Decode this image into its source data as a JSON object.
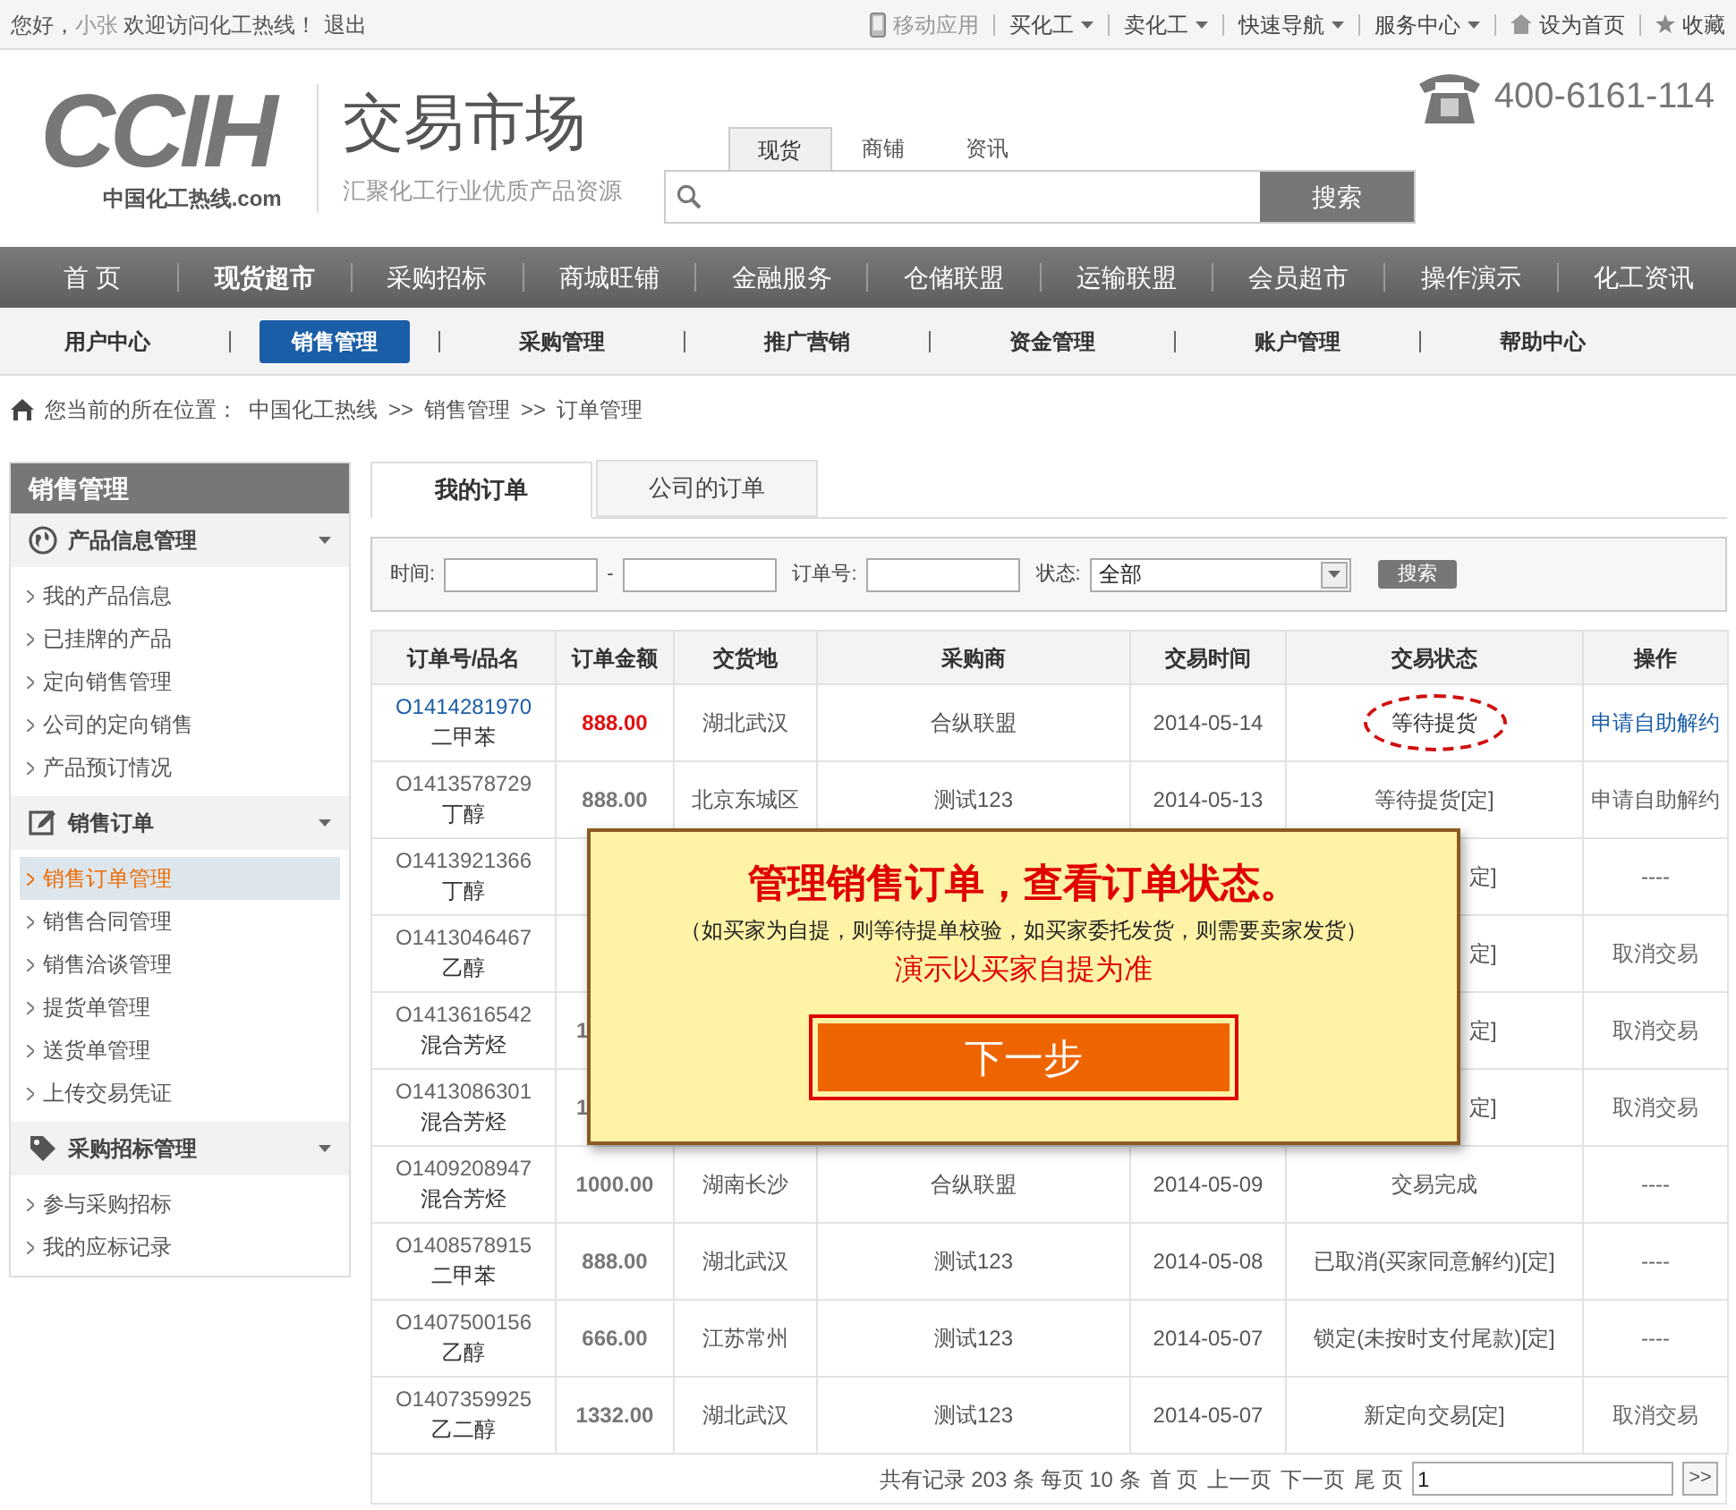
{
  "top_bar": {
    "greeting": "您好，",
    "user": "小张",
    "welcome": "欢迎访问化工热线！",
    "logout": "退出",
    "links": [
      {
        "label": "移动应用",
        "kind": "phone",
        "dropdown": false
      },
      {
        "label": "买化工",
        "kind": "text",
        "dropdown": true
      },
      {
        "label": "卖化工",
        "kind": "text",
        "dropdown": true
      },
      {
        "label": "快速导航",
        "kind": "text",
        "dropdown": true
      },
      {
        "label": "服务中心",
        "kind": "text",
        "dropdown": true
      },
      {
        "label": "设为首页",
        "kind": "home",
        "dropdown": false
      },
      {
        "label": "收藏",
        "kind": "star",
        "dropdown": false
      }
    ]
  },
  "header": {
    "logo_text": "CCIH",
    "logo_sub": "中国化工热线.com",
    "site_title": "交易市场",
    "slogan": "汇聚化工行业优质产品资源",
    "search_tabs": [
      {
        "label": "现货",
        "selected": true
      },
      {
        "label": "商铺",
        "selected": false
      },
      {
        "label": "资讯",
        "selected": false
      }
    ],
    "search_button": "搜索",
    "phone": "400-6161-114"
  },
  "main_nav": [
    {
      "label": "首 页",
      "selected": false
    },
    {
      "label": "现货超市",
      "selected": true
    },
    {
      "label": "采购招标",
      "selected": false
    },
    {
      "label": "商城旺铺",
      "selected": false
    },
    {
      "label": "金融服务",
      "selected": false
    },
    {
      "label": "仓储联盟",
      "selected": false
    },
    {
      "label": "运输联盟",
      "selected": false
    },
    {
      "label": "会员超市",
      "selected": false
    },
    {
      "label": "操作演示",
      "selected": false
    },
    {
      "label": "化工资讯",
      "selected": false
    }
  ],
  "sub_nav": [
    {
      "label": "用户中心",
      "selected": false
    },
    {
      "label": "销售管理",
      "selected": true
    },
    {
      "label": "采购管理",
      "selected": false
    },
    {
      "label": "推广营销",
      "selected": false
    },
    {
      "label": "资金管理",
      "selected": false
    },
    {
      "label": "账户管理",
      "selected": false
    },
    {
      "label": "帮助中心",
      "selected": false
    }
  ],
  "breadcrumb": {
    "prefix": "您当前的所在位置：",
    "items": [
      "中国化工热线",
      "销售管理",
      "订单管理"
    ],
    "separator": ">>"
  },
  "sidebar": {
    "title": "销售管理",
    "groups": [
      {
        "label": "产品信息管理",
        "kind": "globe",
        "expanded": true,
        "items": [
          {
            "label": "我的产品信息",
            "selected": false
          },
          {
            "label": "已挂牌的产品",
            "selected": false
          },
          {
            "label": "定向销售管理",
            "selected": false
          },
          {
            "label": "公司的定向销售",
            "selected": false
          },
          {
            "label": "产品预订情况",
            "selected": false
          }
        ]
      },
      {
        "label": "销售订单",
        "kind": "edit",
        "expanded": true,
        "items": [
          {
            "label": "销售订单管理",
            "selected": true
          },
          {
            "label": "销售合同管理",
            "selected": false
          },
          {
            "label": "销售洽谈管理",
            "selected": false
          },
          {
            "label": "提货单管理",
            "selected": false
          },
          {
            "label": "送货单管理",
            "selected": false
          },
          {
            "label": "上传交易凭证",
            "selected": false
          }
        ]
      },
      {
        "label": "采购招标管理",
        "kind": "tag",
        "expanded": true,
        "items": [
          {
            "label": "参与采购招标",
            "selected": false
          },
          {
            "label": "我的应标记录",
            "selected": false
          }
        ]
      }
    ]
  },
  "tabs": [
    {
      "label": "我的订单",
      "selected": true
    },
    {
      "label": "公司的订单",
      "selected": false
    }
  ],
  "filter": {
    "time_label": "时间:",
    "dash": "-",
    "order_label": "订单号:",
    "status_label": "状态:",
    "status_value": "全部",
    "search_button": "搜索"
  },
  "table": {
    "columns": [
      "订单号/品名",
      "订单金额",
      "交货地",
      "采购商",
      "交易时间",
      "交易状态",
      "操作"
    ],
    "rows": [
      {
        "order_no": "O1414281970",
        "product": "二甲苯",
        "amount": "888.00",
        "location": "湖北武汉",
        "buyer": "合纵联盟",
        "date": "2014-05-14",
        "status": "等待提货",
        "action": "申请自助解约",
        "highlighted": true
      },
      {
        "order_no": "O1413578729",
        "product": "丁醇",
        "amount": "888.00",
        "location": "北京东城区",
        "buyer": "测试123",
        "date": "2014-05-13",
        "status": "等待提货[定]",
        "action": "申请自助解约",
        "highlighted": false
      },
      {
        "order_no": "O1413921366",
        "product": "丁醇",
        "status": "定]",
        "action": "----",
        "highlighted": false
      },
      {
        "order_no": "O1413046467",
        "product": "乙醇",
        "status": "定]",
        "action": "取消交易",
        "highlighted": false
      },
      {
        "order_no": "O1413616542",
        "product": "混合芳烃",
        "amount": "1",
        "status": "定]",
        "action": "取消交易",
        "highlighted": false
      },
      {
        "order_no": "O1413086301",
        "product": "混合芳烃",
        "amount": "1",
        "status": "定]",
        "action": "取消交易",
        "highlighted": false
      },
      {
        "order_no": "O1409208947",
        "product": "混合芳烃",
        "amount": "1000.00",
        "location": "湖南长沙",
        "buyer": "合纵联盟",
        "date": "2014-05-09",
        "status": "交易完成",
        "action": "----",
        "highlighted": false
      },
      {
        "order_no": "O1408578915",
        "product": "二甲苯",
        "amount": "888.00",
        "location": "湖北武汉",
        "buyer": "测试123",
        "date": "2014-05-08",
        "status": "已取消(买家同意解约)[定]",
        "action": "----",
        "highlighted": false
      },
      {
        "order_no": "O1407500156",
        "product": "乙醇",
        "amount": "666.00",
        "location": "江苏常州",
        "buyer": "测试123",
        "date": "2014-05-07",
        "status": "锁定(未按时支付尾款)[定]",
        "action": "----",
        "highlighted": false
      },
      {
        "order_no": "O1407359925",
        "product": "乙二醇",
        "amount": "1332.00",
        "location": "湖北武汉",
        "buyer": "测试123",
        "date": "2014-05-07",
        "status": "新定向交易[定]",
        "action": "取消交易",
        "highlighted": false
      }
    ]
  },
  "pagination": {
    "summary": "共有记录 203 条 每页 10 条",
    "links": [
      "首 页",
      "上一页",
      "下一页",
      "尾 页"
    ],
    "page_value": "1",
    "go_button": ">>"
  },
  "guide": {
    "title": "管理销售订单，查看订单状态。",
    "note": "（如买家为自提，则等待提单校验，如买家委托发货，则需要卖家发货）",
    "emphasis": "演示以买家自提为准",
    "button": "下一步"
  }
}
